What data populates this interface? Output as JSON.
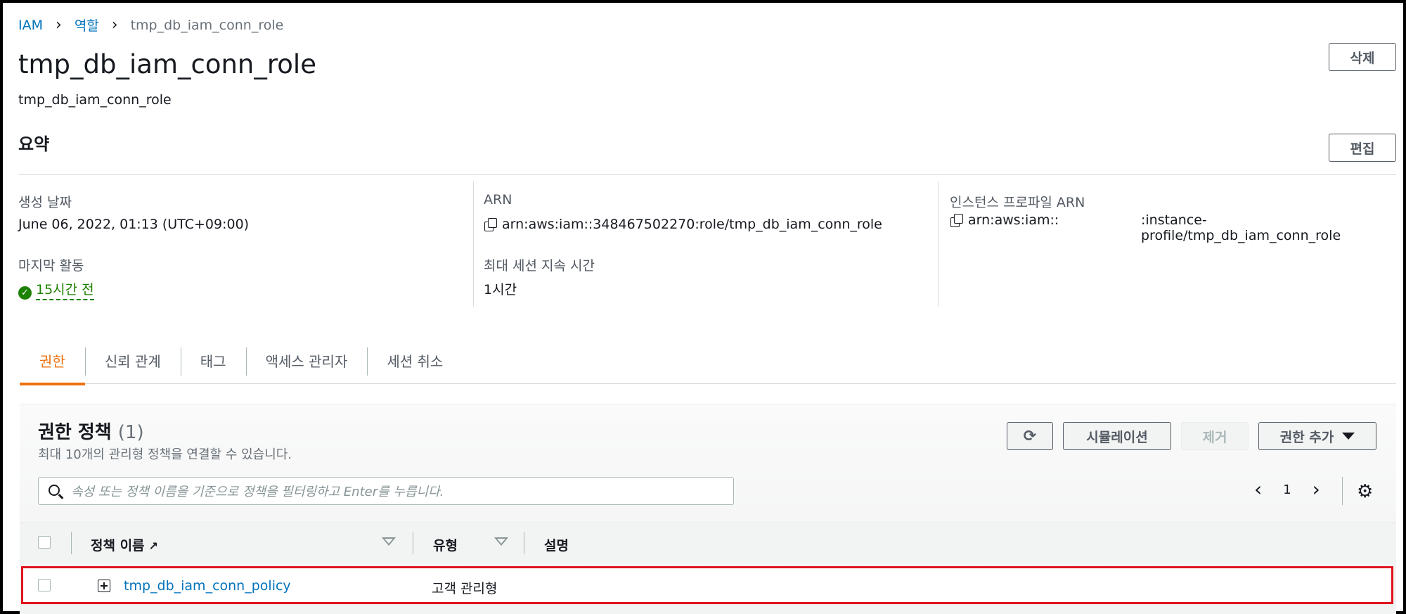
{
  "breadcrumb": {
    "root": "IAM",
    "section": "역할",
    "current": "tmp_db_iam_conn_role"
  },
  "header": {
    "title": "tmp_db_iam_conn_role",
    "subtitle": "tmp_db_iam_conn_role",
    "delete_label": "삭제"
  },
  "summary": {
    "title": "요약",
    "edit_label": "편집",
    "created_label": "생성 날짜",
    "created_value": "June 06, 2022, 01:13 (UTC+09:00)",
    "last_activity_label": "마지막 활동",
    "last_activity_value": "15시간 전",
    "arn_label": "ARN",
    "arn_value": "arn:aws:iam::348467502270:role/tmp_db_iam_conn_role",
    "max_session_label": "최대 세션 지속 시간",
    "max_session_value": "1시간",
    "instance_profile_label": "인스턴스 프로파일 ARN",
    "instance_profile_prefix": "arn:aws:iam::",
    "instance_profile_suffix": ":instance-profile/tmp_db_iam_conn_role"
  },
  "tabs": [
    {
      "label": "권한",
      "active": true
    },
    {
      "label": "신뢰 관계"
    },
    {
      "label": "태그"
    },
    {
      "label": "액세스 관리자"
    },
    {
      "label": "세션 취소"
    }
  ],
  "policies": {
    "title": "권한 정책",
    "count": "(1)",
    "subtitle": "최대 10개의 관리형 정책을 연결할 수 있습니다.",
    "simulate_label": "시뮬레이션",
    "remove_label": "제거",
    "add_label": "권한 추가",
    "search_placeholder": "속성 또는 정책 이름을 기준으로 정책을 필터링하고 Enter를 누릅니다.",
    "page": "1",
    "columns": {
      "name": "정책 이름",
      "type": "유형",
      "description": "설명"
    },
    "rows": [
      {
        "name": "tmp_db_iam_conn_policy",
        "type": "고객 관리형",
        "description": ""
      }
    ]
  },
  "colors": {
    "link": "#0073bb",
    "active_tab": "#ec7211",
    "success": "#1d8102",
    "highlight": "#e0141e"
  },
  "icons": [
    "chevron-right-icon",
    "copy-icon",
    "check-circle-icon",
    "refresh-icon",
    "caret-down-icon",
    "search-icon",
    "chevron-left-icon",
    "gear-icon",
    "external-link-icon",
    "expand-icon"
  ]
}
